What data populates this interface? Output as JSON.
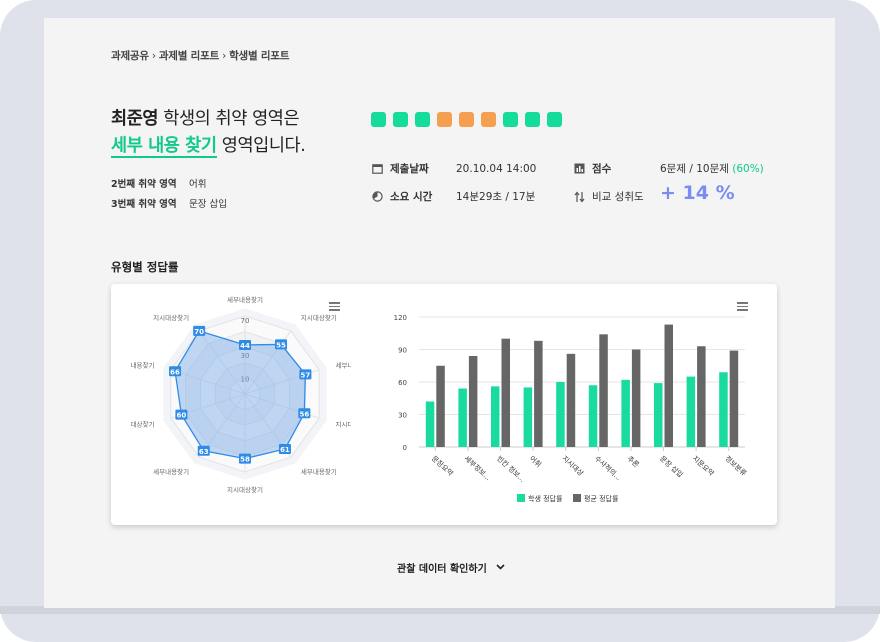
{
  "breadcrumb": [
    "과제공유",
    "과제별 리포트",
    "학생별 리포트"
  ],
  "headline": {
    "student_name": "최준영",
    "suffix1": " 학생의 취약 영역은",
    "weak_area": "세부 내용 찾기",
    "suffix2": " 영역입니다."
  },
  "weak_areas": [
    {
      "label": "2번째 취약 영역",
      "value": "어휘"
    },
    {
      "label": "3번째 취약 영역",
      "value": "문장 삽입"
    }
  ],
  "answer_dots": [
    "#15dc9a",
    "#15dc9a",
    "#15dc9a",
    "#f5a050",
    "#f5a050",
    "#f5a050",
    "#15dc9a",
    "#15dc9a",
    "#15dc9a"
  ],
  "stats": {
    "submit_label": "제출날짜",
    "submit_value": "20.10.04 14:00",
    "time_label": "소요 시간",
    "time_value": "14분29초 / 17분",
    "score_label": "점수",
    "score_value": "6문제 / 10문제",
    "score_pct": "(60%)",
    "compare_label": "비교 성취도",
    "compare_value": "+ 14 %"
  },
  "section_title": "유형별 정답률",
  "view_more": "관찰 데이터 확인하기",
  "colors": {
    "accent": "#10c98a",
    "student_bar": "#19dba0",
    "avg_bar": "#666666",
    "improve": "#7b8cf0"
  },
  "icons": {
    "calendar": "calendar-icon",
    "clock": "clock-icon",
    "score": "bar-chart-icon",
    "compare": "swap-arrows-icon",
    "menu": "hamburger-menu-icon",
    "chevron": "chevron-down-icon"
  },
  "chart_data": [
    {
      "type": "radar",
      "axes": [
        "세부내용찾기",
        "지시대상찾기",
        "세부내",
        "지시대",
        "세부내용찾기",
        "지시대상찾기",
        "세부내용찾기",
        "대상찾기",
        "내용찾기",
        "지시대상찾기"
      ],
      "values": [
        44,
        55,
        57,
        56,
        61,
        58,
        63,
        60,
        66,
        70
      ],
      "ticks": [
        "10",
        "30",
        "70"
      ],
      "max": 70
    },
    {
      "type": "bar",
      "categories": [
        "문장요약",
        "세부정보...",
        "빈칸 정보...",
        "어휘",
        "지시대상",
        "수사적의...",
        "추론",
        "문장 삽입",
        "지문요약",
        "정보분류"
      ],
      "series": [
        {
          "name": "학생 정답률",
          "values": [
            42,
            54,
            56,
            55,
            60,
            57,
            62,
            59,
            65,
            69
          ]
        },
        {
          "name": "평균 정답률",
          "values": [
            75,
            84,
            100,
            98,
            86,
            104,
            90,
            113,
            93,
            89
          ]
        }
      ],
      "yticks": [
        0,
        30,
        60,
        90,
        120
      ],
      "ylim": [
        0,
        120
      ]
    }
  ]
}
